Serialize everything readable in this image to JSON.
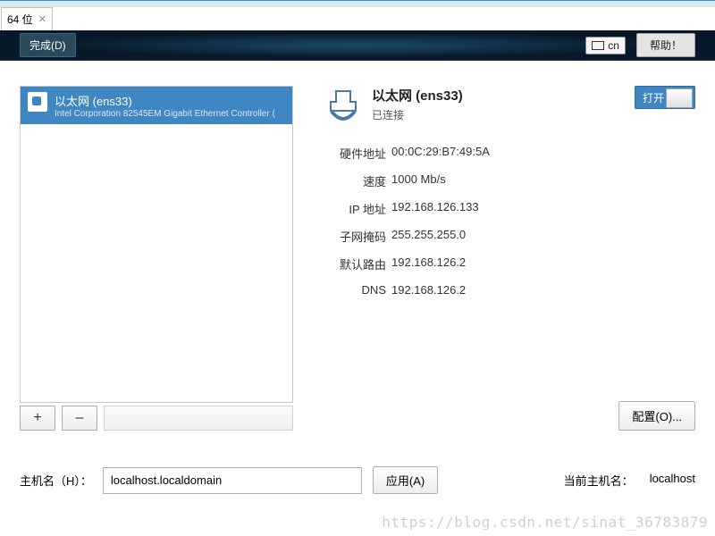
{
  "tab": {
    "label": "64 位"
  },
  "topbar": {
    "done": "完成(D)",
    "ime": "cn",
    "help": "帮助！"
  },
  "sidebar": {
    "items": [
      {
        "title": "以太网 (ens33)",
        "subtitle": "Intel Corporation 82545EM Gigabit Ethernet Controller ("
      }
    ],
    "add": "+",
    "remove": "–"
  },
  "detail": {
    "title": "以太网 (ens33)",
    "status": "已连接",
    "toggle_label": "打开",
    "props": [
      {
        "label": "硬件地址",
        "value": "00:0C:29:B7:49:5A"
      },
      {
        "label": "速度",
        "value": "1000 Mb/s"
      },
      {
        "label": "IP 地址",
        "value": "192.168.126.133"
      },
      {
        "label": "子网掩码",
        "value": "255.255.255.0"
      },
      {
        "label": "默认路由",
        "value": "192.168.126.2"
      },
      {
        "label": "DNS",
        "value": "192.168.126.2"
      }
    ],
    "configure": "配置(O)..."
  },
  "hostname": {
    "label": "主机名（H）：",
    "value": "localhost.localdomain",
    "apply": "应用(A)",
    "current_label": "当前主机名：",
    "current_value": "localhost"
  },
  "watermark": "https://blog.csdn.net/sinat_36783879"
}
